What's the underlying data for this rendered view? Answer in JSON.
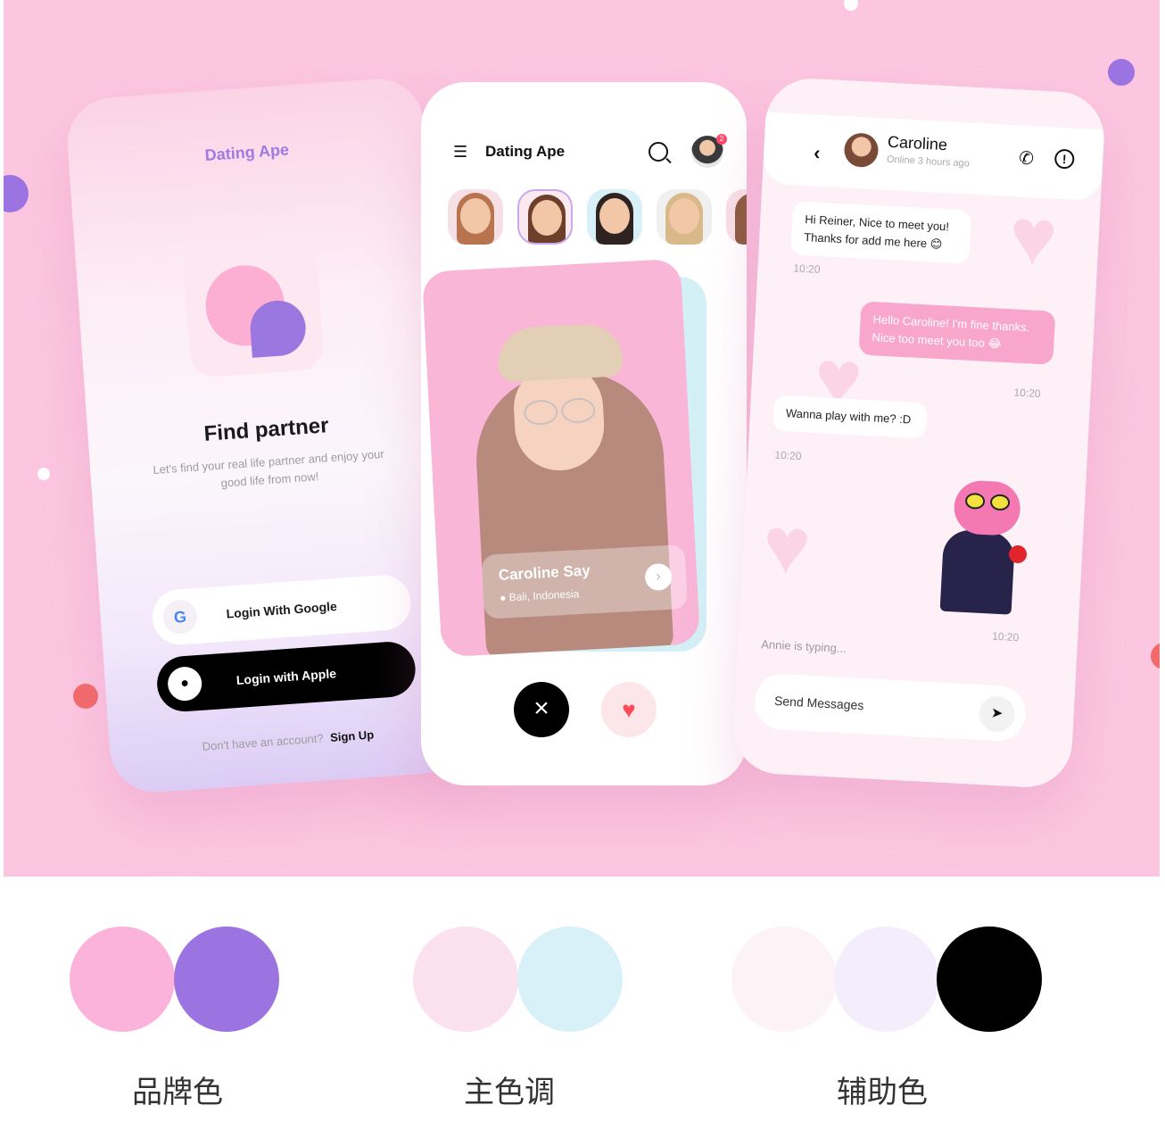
{
  "colors": {
    "background": "#fcc6e1",
    "brand_pink": "#fbb3dc",
    "brand_purple": "#9c74e1",
    "main_pink": "#fbe0ed",
    "main_blue": "#d8f1f8",
    "aux_white_pink": "#fdf3f7",
    "aux_lavender": "#f3edfc",
    "aux_black": "#000000"
  },
  "login_screen": {
    "brand": "Dating Ape",
    "title": "Find partner",
    "subtitle": "Let's find your real life partner and enjoy your good life from now!",
    "google_button": "Login With Google",
    "apple_button": "Login with Apple",
    "signup_prompt": "Don't have an account?",
    "signup_link": "Sign Up"
  },
  "discover_screen": {
    "title": "Dating Ape",
    "notification_count": "2",
    "stories": [
      "story-1",
      "story-2",
      "story-3",
      "story-4"
    ],
    "profile_name": "Caroline Say",
    "profile_location": "Bali, Indonesia"
  },
  "chat_screen": {
    "contact_name": "Caroline",
    "contact_status": "Online 3 hours ago",
    "messages": [
      {
        "text": "Hi Reiner, Nice to meet you! Thanks for add me here 😊",
        "time": "10:20"
      },
      {
        "text": "Hello Caroline! I'm fine thanks. Nice too meet you too 😂",
        "time": "10:20"
      },
      {
        "text": "Wanna play with me? :D",
        "time": "10:20"
      },
      {
        "text": "",
        "time": "10:20"
      }
    ],
    "typing": "Annie is typing...",
    "input_placeholder": "Send Messages"
  },
  "palette": {
    "brand_label": "品牌色",
    "main_label": "主色调",
    "aux_label": "辅助色"
  }
}
